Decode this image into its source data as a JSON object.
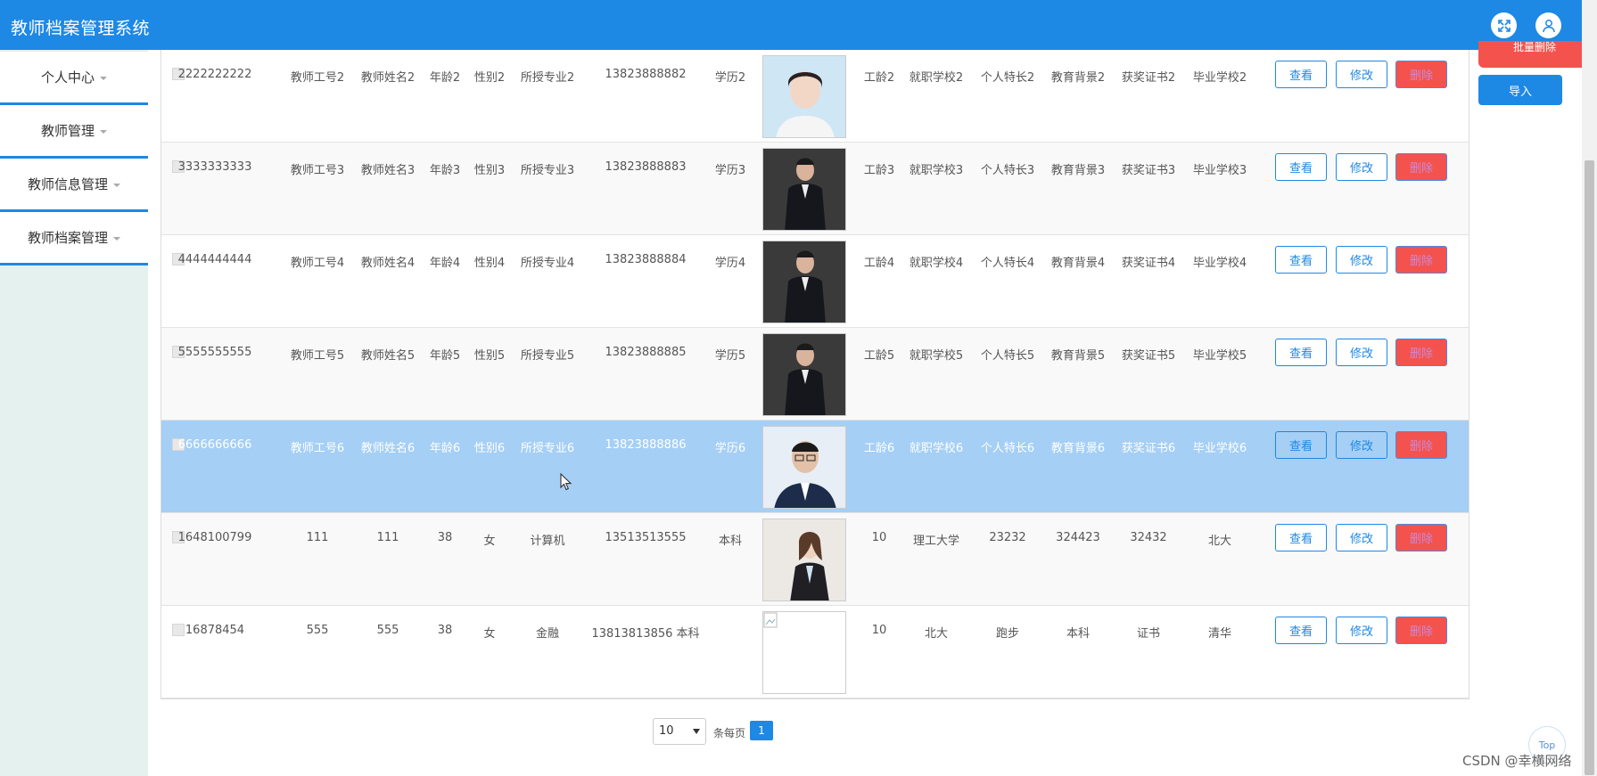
{
  "app": {
    "title": "教师档案管理系统"
  },
  "header": {
    "icons": [
      "fullscreen-icon",
      "user-icon"
    ],
    "color": "#1E88E5"
  },
  "sidebar": {
    "items": [
      {
        "label": "个人中心"
      },
      {
        "label": "教师管理"
      },
      {
        "label": "教师信息管理"
      },
      {
        "label": "教师档案管理"
      }
    ]
  },
  "actions": {
    "batch_delete": "批量删除",
    "import": "导入"
  },
  "table": {
    "rows": [
      {
        "id": "2222222222",
        "job_no": "教师工号2",
        "name": "教师姓名2",
        "age": "年龄2",
        "gender": "性别2",
        "major": "所授专业2",
        "phone": "13823888882",
        "edu": "学历2",
        "photo": "woman-portrait",
        "years": "工龄2",
        "school": "就职学校2",
        "specialty": "个人特长2",
        "background": "教育背景2",
        "awards": "获奖证书2",
        "grad": "毕业学校2"
      },
      {
        "id": "3333333333",
        "job_no": "教师工号3",
        "name": "教师姓名3",
        "age": "年龄3",
        "gender": "性别3",
        "major": "所授专业3",
        "phone": "13823888883",
        "edu": "学历3",
        "photo": "man-suit-portrait",
        "years": "工龄3",
        "school": "就职学校3",
        "specialty": "个人特长3",
        "background": "教育背景3",
        "awards": "获奖证书3",
        "grad": "毕业学校3"
      },
      {
        "id": "4444444444",
        "job_no": "教师工号4",
        "name": "教师姓名4",
        "age": "年龄4",
        "gender": "性别4",
        "major": "所授专业4",
        "phone": "13823888884",
        "edu": "学历4",
        "photo": "man-suit-portrait",
        "years": "工龄4",
        "school": "就职学校4",
        "specialty": "个人特长4",
        "background": "教育背景4",
        "awards": "获奖证书4",
        "grad": "毕业学校4"
      },
      {
        "id": "5555555555",
        "job_no": "教师工号5",
        "name": "教师姓名5",
        "age": "年龄5",
        "gender": "性别5",
        "major": "所授专业5",
        "phone": "13823888885",
        "edu": "学历5",
        "photo": "man-suit-portrait",
        "years": "工龄5",
        "school": "就职学校5",
        "specialty": "个人特长5",
        "background": "教育背景5",
        "awards": "获奖证书5",
        "grad": "毕业学校5"
      },
      {
        "id": "6666666666",
        "job_no": "教师工号6",
        "name": "教师姓名6",
        "age": "年龄6",
        "gender": "性别6",
        "major": "所授专业6",
        "phone": "13823888886",
        "edu": "学历6",
        "photo": "man-glasses-portrait",
        "years": "工龄6",
        "school": "就职学校6",
        "specialty": "个人特长6",
        "background": "教育背景6",
        "awards": "获奖证书6",
        "grad": "毕业学校6"
      },
      {
        "id": "1648100799",
        "job_no": "111",
        "name": "111",
        "age": "38",
        "gender": "女",
        "major": "计算机",
        "phone": "13513513555",
        "edu": "本科",
        "photo": "woman-office-portrait",
        "years": "10",
        "school": "理工大学",
        "specialty": "23232",
        "background": "324423",
        "awards": "32432",
        "grad": "北大"
      },
      {
        "id": "16878454",
        "job_no": "555",
        "name": "555",
        "age": "38",
        "gender": "女",
        "major": "金融",
        "phone": "13813813856 本科",
        "edu": "",
        "photo": "broken-image",
        "years": "10",
        "school": "北大",
        "specialty": "跑步",
        "background": "本科",
        "awards": "证书",
        "grad": "清华"
      }
    ],
    "buttons": {
      "view": "查看",
      "edit": "修改",
      "delete": "删除"
    },
    "selected_row": 4
  },
  "pagination": {
    "page_size": "10",
    "per_page_label": "条每页",
    "current_page": "1"
  },
  "back_to_top": "Top",
  "watermark": "CSDN @幸横网络"
}
